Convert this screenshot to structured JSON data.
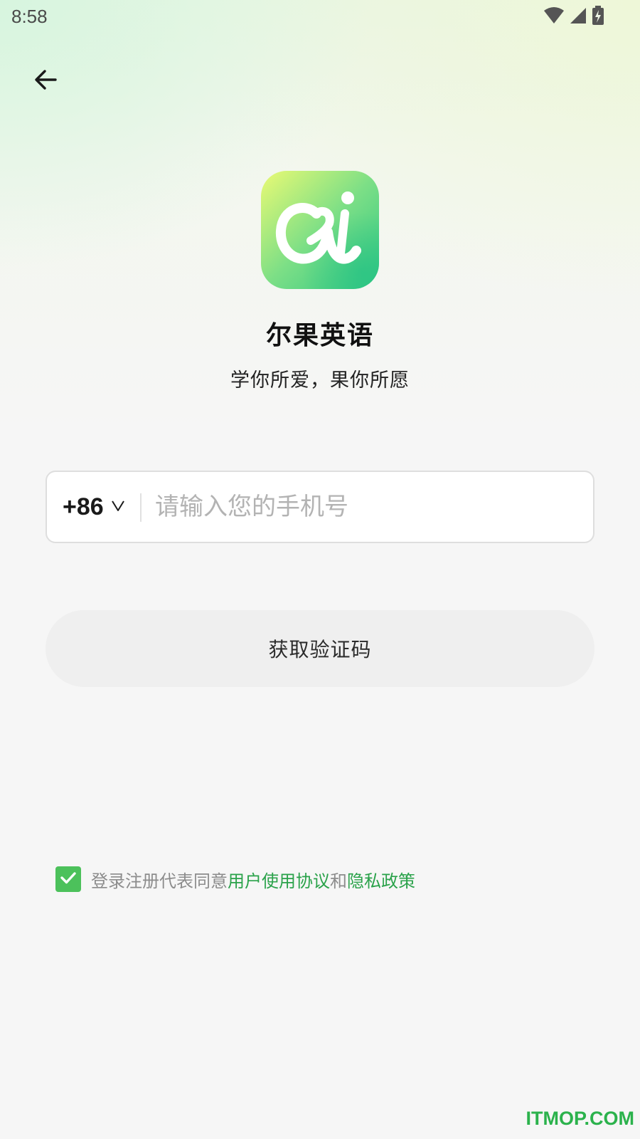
{
  "status_bar": {
    "time": "8:58",
    "icons": [
      "wifi-icon",
      "cell-signal-icon",
      "battery-charging-icon"
    ]
  },
  "header": {
    "back_icon": "arrow-left-icon"
  },
  "brand": {
    "app_name": "尔果英语",
    "slogan": "学你所爱，果你所愿",
    "logo_colors": [
      "#eafa74",
      "#7ddf86",
      "#2fc783"
    ]
  },
  "phone_form": {
    "country_code": "+86",
    "country_dropdown_icon": "chevron-down-icon",
    "phone_value": "",
    "phone_placeholder": "请输入您的手机号"
  },
  "actions": {
    "get_code_label": "获取验证码"
  },
  "agreement": {
    "checked": true,
    "prefix": "登录注册代表同意",
    "terms_link": "用户使用协议",
    "joiner": "和",
    "privacy_link": "隐私政策"
  },
  "watermark": "ITMOP.COM",
  "colors": {
    "accent_green": "#2aa24a",
    "checkbox_green": "#4cc15b",
    "button_bg": "#efefef",
    "page_bg": "#f6f6f6"
  }
}
